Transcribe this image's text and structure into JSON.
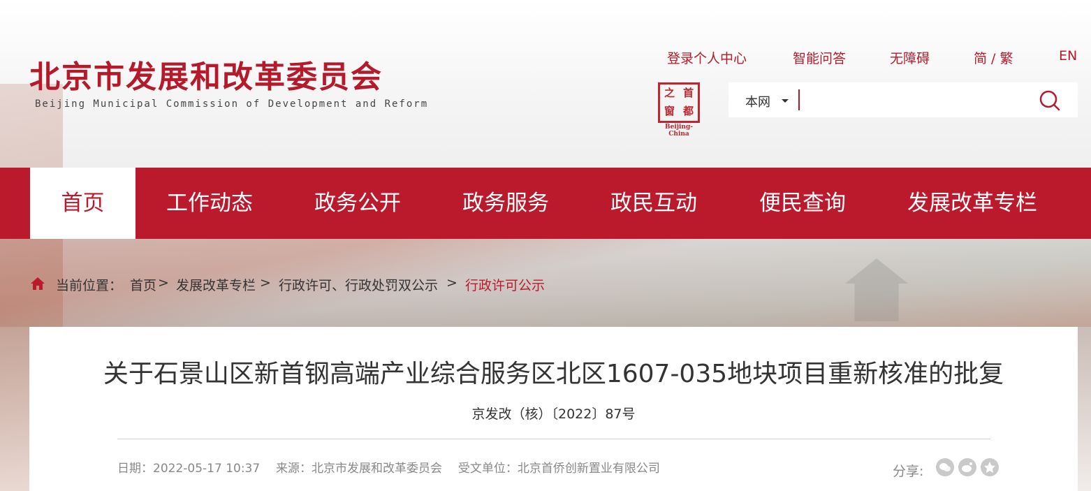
{
  "header": {
    "site_title": "北京市发展和改革委员会",
    "site_subtitle": "Beijing Municipal Commission of Development and Reform",
    "top_links": [
      "登录个人中心",
      "智能问答",
      "无障碍",
      "简 / 繁",
      "EN"
    ],
    "seal": {
      "chars": [
        "之",
        "首",
        "窗",
        "都"
      ],
      "caption": "Beijing-China"
    },
    "search": {
      "scope": "本网",
      "placeholder": ""
    }
  },
  "nav": {
    "items": [
      "首页",
      "工作动态",
      "政务公开",
      "政务服务",
      "政民互动",
      "便民查询",
      "发展改革专栏"
    ],
    "active": "首页"
  },
  "breadcrumb": {
    "label": "当前位置：",
    "items": [
      "首页",
      "发展改革专栏",
      "行政许可、行政处罚双公示",
      "行政许可公示"
    ],
    "separator": " > "
  },
  "article": {
    "title": "关于石景山区新首钢高端产业综合服务区北区1607-035地块项目重新核准的批复",
    "doc_number": "京发改（核）〔2022〕87号",
    "meta": {
      "date_label": "日期：",
      "date": "2022-05-17 10:37",
      "source_label": "来源：",
      "source": "北京市发展和改革委员会",
      "recipient_label": "受文单位：",
      "recipient": "北京首侨创新置业有限公司"
    },
    "share_label": "分享:"
  },
  "colors": {
    "brand_red": "#bb1a2d",
    "text": "#333333",
    "muted": "#888888"
  },
  "icons": [
    "home-icon",
    "search-icon",
    "wechat-icon",
    "weibo-icon",
    "favorite-icon"
  ]
}
